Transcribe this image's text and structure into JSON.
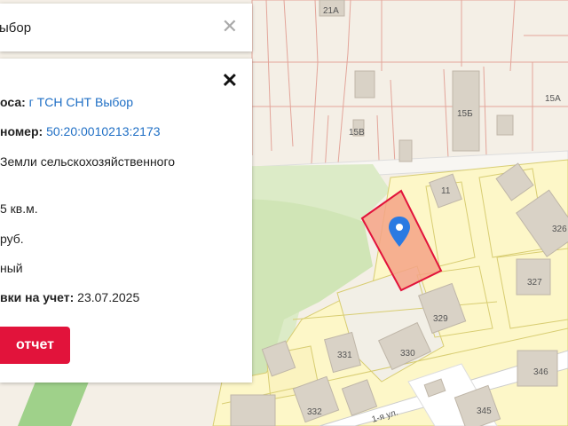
{
  "search": {
    "query": "ыбор"
  },
  "info": {
    "address_label": "оса:",
    "address_value": "г ТСН СНТ Выбор",
    "cadastral_label": "номер:",
    "cadastral_value": "50:20:0010213:2173",
    "category_text": "Земли сельскохозяйственного",
    "area_text": "5 кв.м.",
    "cost_text": "руб.",
    "status_text": "ный",
    "date_label": "вки на учет:",
    "date_value": "23.07.2025",
    "report_button": "отчет"
  },
  "map": {
    "labels": {
      "l21a": "21А",
      "l15v": "15В",
      "l15b": "15Б",
      "l15a": "15А",
      "l11": "11",
      "l326": "326",
      "l327": "327",
      "l329": "329",
      "l330": "330",
      "l331": "331",
      "l332": "332",
      "l345": "345",
      "l346": "346",
      "street": "1-я ул."
    },
    "colors": {
      "parcel_fill": "#fdf7c8",
      "parcel_stroke": "#d8cd72",
      "red_line": "#e3a59a",
      "green_area": "#dcebc7",
      "building": "#d9d2c6",
      "selected_fill": "#f4a386",
      "selected_stroke": "#e2133b",
      "pin": "#2a7ae2"
    }
  }
}
